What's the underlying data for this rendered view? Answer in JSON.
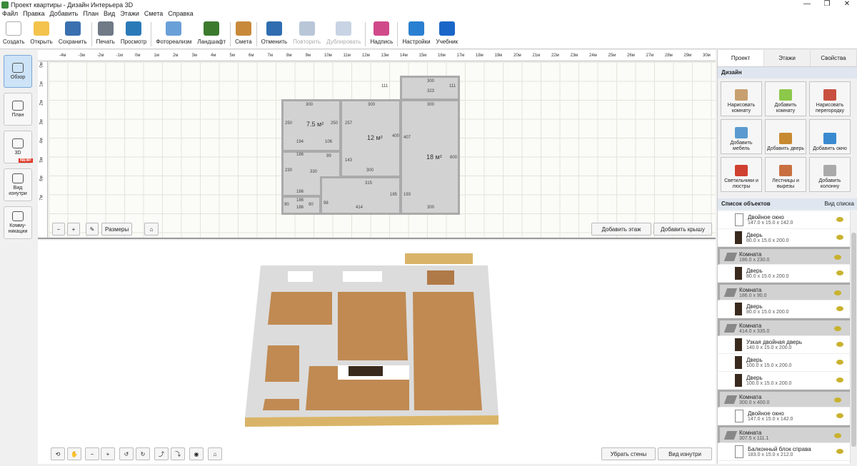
{
  "window": {
    "title": "Проект квартиры - Дизайн Интерьера 3D"
  },
  "menu": [
    "Файл",
    "Правка",
    "Добавить",
    "План",
    "Вид",
    "Этажи",
    "Смета",
    "Справка"
  ],
  "toolbar": [
    {
      "label": "Создать",
      "icon": "new-file-icon",
      "color": "#ffffff"
    },
    {
      "label": "Открыть",
      "icon": "folder-icon",
      "color": "#f3c34c"
    },
    {
      "label": "Сохранить",
      "icon": "save-icon",
      "color": "#3a6fb0"
    },
    {
      "label": "Печать",
      "icon": "printer-icon",
      "color": "#6f7a86"
    },
    {
      "label": "Просмотр",
      "icon": "monitor-icon",
      "color": "#2a7ab8"
    },
    {
      "label": "Фотореализм",
      "icon": "photo-icon",
      "color": "#6aa0d8"
    },
    {
      "label": "Ландшафт",
      "icon": "tree-icon",
      "color": "#3c7a2e"
    },
    {
      "label": "Смета",
      "icon": "estimate-icon",
      "color": "#c88a3a"
    },
    {
      "label": "Отменить",
      "icon": "undo-icon",
      "color": "#2f6db0"
    },
    {
      "label": "Повторить",
      "icon": "redo-icon",
      "color": "#b8c6d8",
      "disabled": true
    },
    {
      "label": "Дублировать",
      "icon": "duplicate-icon",
      "color": "#c8d4e4",
      "disabled": true
    },
    {
      "label": "Надпись",
      "icon": "label-icon",
      "color": "#d04a8a"
    },
    {
      "label": "Настройки",
      "icon": "gear-icon",
      "color": "#2a80d0"
    },
    {
      "label": "Учебник",
      "icon": "help-icon",
      "color": "#1a66c8"
    }
  ],
  "leftbar": [
    {
      "label": "Обзор",
      "active": true
    },
    {
      "label": "План"
    },
    {
      "label": "3D"
    },
    {
      "label": "Вид изнутри"
    },
    {
      "label": "Комму-никации",
      "badge": "NEW!"
    }
  ],
  "ruler": {
    "top": [
      "-4м",
      "-3м",
      "-2м",
      "-1м",
      "0м",
      "1м",
      "2м",
      "3м",
      "4м",
      "5м",
      "6м",
      "7м",
      "8м",
      "9м",
      "10м",
      "11м",
      "12м",
      "13м",
      "14м",
      "15м",
      "16м",
      "17м",
      "18м",
      "19м",
      "20м",
      "21м",
      "22м",
      "23м",
      "24м",
      "25м",
      "26м",
      "27м",
      "28м",
      "29м",
      "30м"
    ],
    "left": [
      "0м",
      "1м",
      "2м",
      "3м",
      "4м",
      "5м",
      "6м",
      "7м"
    ]
  },
  "plan": {
    "rooms": [
      {
        "area": "7.5 м²"
      },
      {
        "area": "12 м²"
      },
      {
        "area": "18 м²"
      }
    ],
    "dims": [
      "300",
      "300",
      "300",
      "300",
      "323",
      "111",
      "111",
      "250",
      "250",
      "257",
      "400",
      "407",
      "600",
      "194",
      "106",
      "186",
      "99",
      "143",
      "300",
      "230",
      "330",
      "315",
      "186",
      "185",
      "193",
      "90",
      "186",
      "186",
      "90",
      "98",
      "414",
      "300"
    ],
    "controls": {
      "dimensions": "Размеры",
      "add_floor": "Добавить этаж",
      "add_roof": "Добавить крышу"
    }
  },
  "view3d": {
    "remove_walls": "Убрать стены",
    "inside_view": "Вид изнутри"
  },
  "right": {
    "tabs": [
      "Проект",
      "Этажи",
      "Свойства"
    ],
    "design_header": "Дизайн",
    "design_buttons": [
      {
        "label": "Нарисовать комнату",
        "icon": "draw-room-icon",
        "color": "#c8a070"
      },
      {
        "label": "Добавить комнату",
        "icon": "add-room-icon",
        "color": "#8cc84a"
      },
      {
        "label": "Нарисовать перегородку",
        "icon": "brick-wall-icon",
        "color": "#c85040"
      },
      {
        "label": "Добавить мебель",
        "icon": "chair-icon",
        "color": "#5a9ad0"
      },
      {
        "label": "Добавить дверь",
        "icon": "door-icon",
        "color": "#c88a30"
      },
      {
        "label": "Добавить окно",
        "icon": "window-icon",
        "color": "#3a8ad0"
      },
      {
        "label": "Светильники и люстры",
        "icon": "lamp-icon",
        "color": "#d04030"
      },
      {
        "label": "Лестницы и вырезы",
        "icon": "stairs-icon",
        "color": "#c87040"
      },
      {
        "label": "Добавить колонну",
        "icon": "column-icon",
        "color": "#aaaaaa"
      }
    ],
    "list_header": "Список объектов",
    "list_view": "Вид списка",
    "objects": [
      {
        "name": "Двойное окно",
        "size": "147.0 x 15.0 x 142.0",
        "kind": "win"
      },
      {
        "name": "Дверь",
        "size": "80.0 x 15.0 x 200.0",
        "kind": "door"
      },
      {
        "name": "Комната",
        "size": "186.0 x 230.0",
        "kind": "room"
      },
      {
        "name": "Дверь",
        "size": "80.0 x 15.0 x 200.0",
        "kind": "door"
      },
      {
        "name": "Комната",
        "size": "186.0 x 90.0",
        "kind": "room"
      },
      {
        "name": "Дверь",
        "size": "80.0 x 15.0 x 200.0",
        "kind": "door"
      },
      {
        "name": "Комната",
        "size": "414.0 x 335.0",
        "kind": "room"
      },
      {
        "name": "Узкая двойная дверь",
        "size": "140.0 x 15.0 x 200.0",
        "kind": "door"
      },
      {
        "name": "Дверь",
        "size": "100.0 x 15.0 x 200.0",
        "kind": "door"
      },
      {
        "name": "Дверь",
        "size": "100.0 x 15.0 x 200.0",
        "kind": "door"
      },
      {
        "name": "Комната",
        "size": "300.0 x 400.0",
        "kind": "room"
      },
      {
        "name": "Двойное окно",
        "size": "147.0 x 15.0 x 142.0",
        "kind": "win"
      },
      {
        "name": "Комната",
        "size": "307.5 x 111.1",
        "kind": "room"
      },
      {
        "name": "Балконный блок справа",
        "size": "183.0 x 15.0 x 212.0",
        "kind": "win"
      }
    ]
  },
  "colors": {
    "floor": "#c08a52",
    "wall": "#e8e8e8",
    "accent": "#cde3f7"
  }
}
